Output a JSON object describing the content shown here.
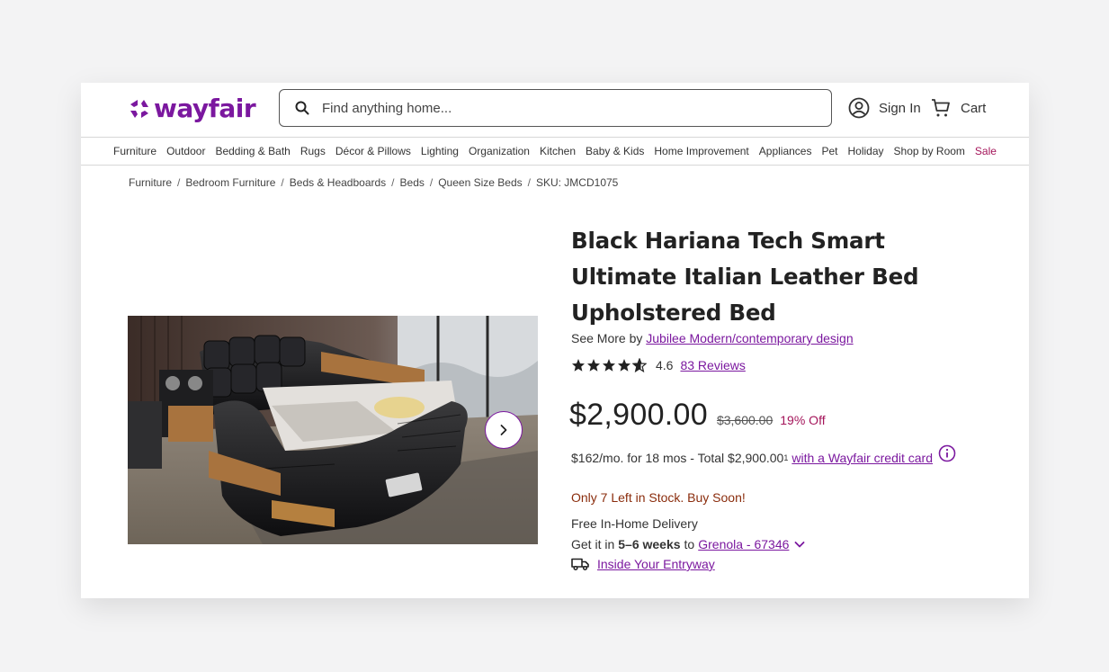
{
  "brand": {
    "name": "wayfair",
    "color": "#7b189f"
  },
  "search": {
    "placeholder": "Find anything home..."
  },
  "account": {
    "sign_in": "Sign In",
    "cart": "Cart"
  },
  "nav": [
    "Furniture",
    "Outdoor",
    "Bedding & Bath",
    "Rugs",
    "Décor & Pillows",
    "Lighting",
    "Organization",
    "Kitchen",
    "Baby & Kids",
    "Home Improvement",
    "Appliances",
    "Pet",
    "Holiday",
    "Shop by Room",
    "Sale"
  ],
  "breadcrumb": [
    "Furniture",
    "Bedroom Furniture",
    "Beds & Headboards",
    "Beds",
    "Queen Size Beds",
    "SKU: JMCD1075"
  ],
  "product": {
    "title": "Black Hariana Tech Smart Ultimate Italian Leather Bed Upholstered Bed",
    "see_more_prefix": "See More by",
    "brand_link": "Jubilee Modern/contemporary design",
    "rating": "4.6",
    "rating_value": 4.6,
    "reviews": "83 Reviews",
    "price": "$2,900.00",
    "was_price": "$3,600.00",
    "discount": "19% Off",
    "finance_text": "$162/mo. for 18 mos - Total $2,900.00",
    "finance_sup": "1",
    "finance_link": "with a Wayfair credit card",
    "stock": "Only 7 Left in Stock. Buy Soon!",
    "delivery": "Free In-Home Delivery",
    "get_it_prefix": "Get it in",
    "get_it_weeks": "5–6 weeks",
    "get_it_to": "to",
    "location": "Grenola - 67346",
    "entry_link": "Inside Your Entryway"
  },
  "colors": {
    "accent": "#7b189f",
    "sale": "#a4155a",
    "stock_warning": "#8a2c0c"
  }
}
